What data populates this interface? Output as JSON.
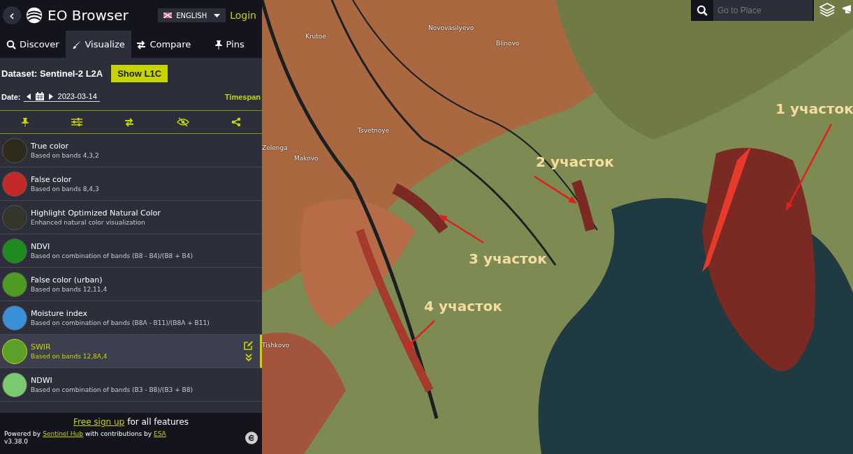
{
  "header": {
    "back": "‹",
    "title": "EO Browser",
    "language": "ENGLISH",
    "login": "Login"
  },
  "tabs": [
    {
      "label": "Discover",
      "selected": false
    },
    {
      "label": "Visualize",
      "selected": true
    },
    {
      "label": "Compare",
      "selected": false
    },
    {
      "label": "Pins",
      "selected": false
    }
  ],
  "dataset": {
    "label": "Dataset: Sentinel-2 L2A",
    "button": "Show L1C"
  },
  "date": {
    "label": "Date:",
    "value": "2023-03-14",
    "timespan": "Timespan"
  },
  "layers": [
    {
      "name": "True color",
      "description": "Based on bands 4,3,2",
      "color": "#2e2a1c",
      "selected": false
    },
    {
      "name": "False color",
      "description": "Based on bands 8,4,3",
      "color": "#c22a2a",
      "selected": false
    },
    {
      "name": "Highlight Optimized Natural Color",
      "description": "Enhanced natural color visualization",
      "color": "#34362a",
      "selected": false
    },
    {
      "name": "NDVI",
      "description": "Based on combination of bands (B8 - B4)/(B8 + B4)",
      "color": "#1f8a1f",
      "selected": false
    },
    {
      "name": "False color (urban)",
      "description": "Based on bands 12,11,4",
      "color": "#4e9a22",
      "selected": false
    },
    {
      "name": "Moisture index",
      "description": "Based on combination of bands (B8A - B11)/(B8A + B11)",
      "color": "#3a8fd6",
      "selected": false
    },
    {
      "name": "SWIR",
      "description": "Based on bands 12,8A,4",
      "color": "#5aa02a",
      "selected": true
    },
    {
      "name": "NDWI",
      "description": "Based on combination of bands (B3 - B8)/(B3 + B8)",
      "color": "#7cc870",
      "selected": false
    }
  ],
  "footer": {
    "signup_link": "Free sign up",
    "signup_rest": "for all features",
    "powered": "Powered by",
    "sentinel_link": "Sentinel Hub",
    "contributions": "with contributions by",
    "esa_link": "ESA",
    "version": "v3.38.0"
  },
  "map": {
    "search": {
      "placeholder": "Go to Place"
    },
    "places": [
      {
        "name": "Krutoe"
      },
      {
        "name": "Novovasilyevo"
      },
      {
        "name": "Blinovo"
      },
      {
        "name": "Tsvetnoye"
      },
      {
        "name": "Zelenga"
      },
      {
        "name": "Makovo"
      },
      {
        "name": "Tishkovo"
      }
    ],
    "annotations": [
      {
        "label": "1 участок"
      },
      {
        "label": "2 участок"
      },
      {
        "label": "3 участок"
      },
      {
        "label": "4 участок"
      }
    ]
  }
}
